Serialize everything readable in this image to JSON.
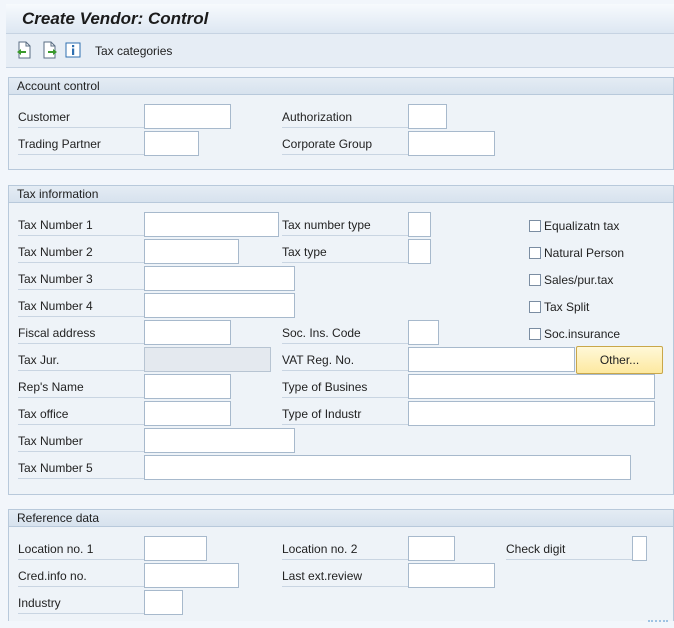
{
  "window": {
    "title": "Create Vendor: Control"
  },
  "toolbar": {
    "icons": [
      "previous-screen-icon",
      "next-screen-icon",
      "info-icon"
    ],
    "tax_categories_label": "Tax categories"
  },
  "account_control": {
    "header": "Account control",
    "customer_label": "Customer",
    "trading_partner_label": "Trading Partner",
    "authorization_label": "Authorization",
    "corporate_group_label": "Corporate Group",
    "customer_value": "",
    "trading_partner_value": "",
    "authorization_value": "",
    "corporate_group_value": ""
  },
  "tax_information": {
    "header": "Tax information",
    "tax_number_1_label": "Tax Number 1",
    "tax_number_2_label": "Tax Number 2",
    "tax_number_3_label": "Tax Number 3",
    "tax_number_4_label": "Tax Number 4",
    "fiscal_address_label": "Fiscal address",
    "tax_jur_label": "Tax Jur.",
    "reps_name_label": "Rep's Name",
    "tax_office_label": "Tax office",
    "tax_number_label": "Tax Number",
    "tax_number_5_label": "Tax Number 5",
    "tax_number_type_label": "Tax number type",
    "tax_type_label": "Tax type",
    "soc_ins_code_label": "Soc. Ins. Code",
    "vat_reg_no_label": "VAT Reg. No.",
    "type_of_business_label": "Type of Busines",
    "type_of_industry_label": "Type of Industr",
    "other_button_label": "Other...",
    "checkboxes": {
      "equalization_tax": {
        "label": "Equalizatn tax",
        "checked": false
      },
      "natural_person": {
        "label": "Natural Person",
        "checked": false
      },
      "sales_pur_tax": {
        "label": "Sales/pur.tax",
        "checked": false
      },
      "tax_split": {
        "label": "Tax Split",
        "checked": false
      },
      "soc_insurance": {
        "label": "Soc.insurance",
        "checked": false
      }
    }
  },
  "reference_data": {
    "header": "Reference data",
    "location_no_1_label": "Location no. 1",
    "location_no_2_label": "Location no. 2",
    "check_digit_label": "Check digit",
    "cred_info_no_label": "Cred.info no.",
    "last_ext_review_label": "Last ext.review",
    "industry_label": "Industry"
  },
  "colors": {
    "background": "#f2f6fb",
    "group_border": "#b8c9db",
    "button_yellow": "#fde9a0"
  }
}
